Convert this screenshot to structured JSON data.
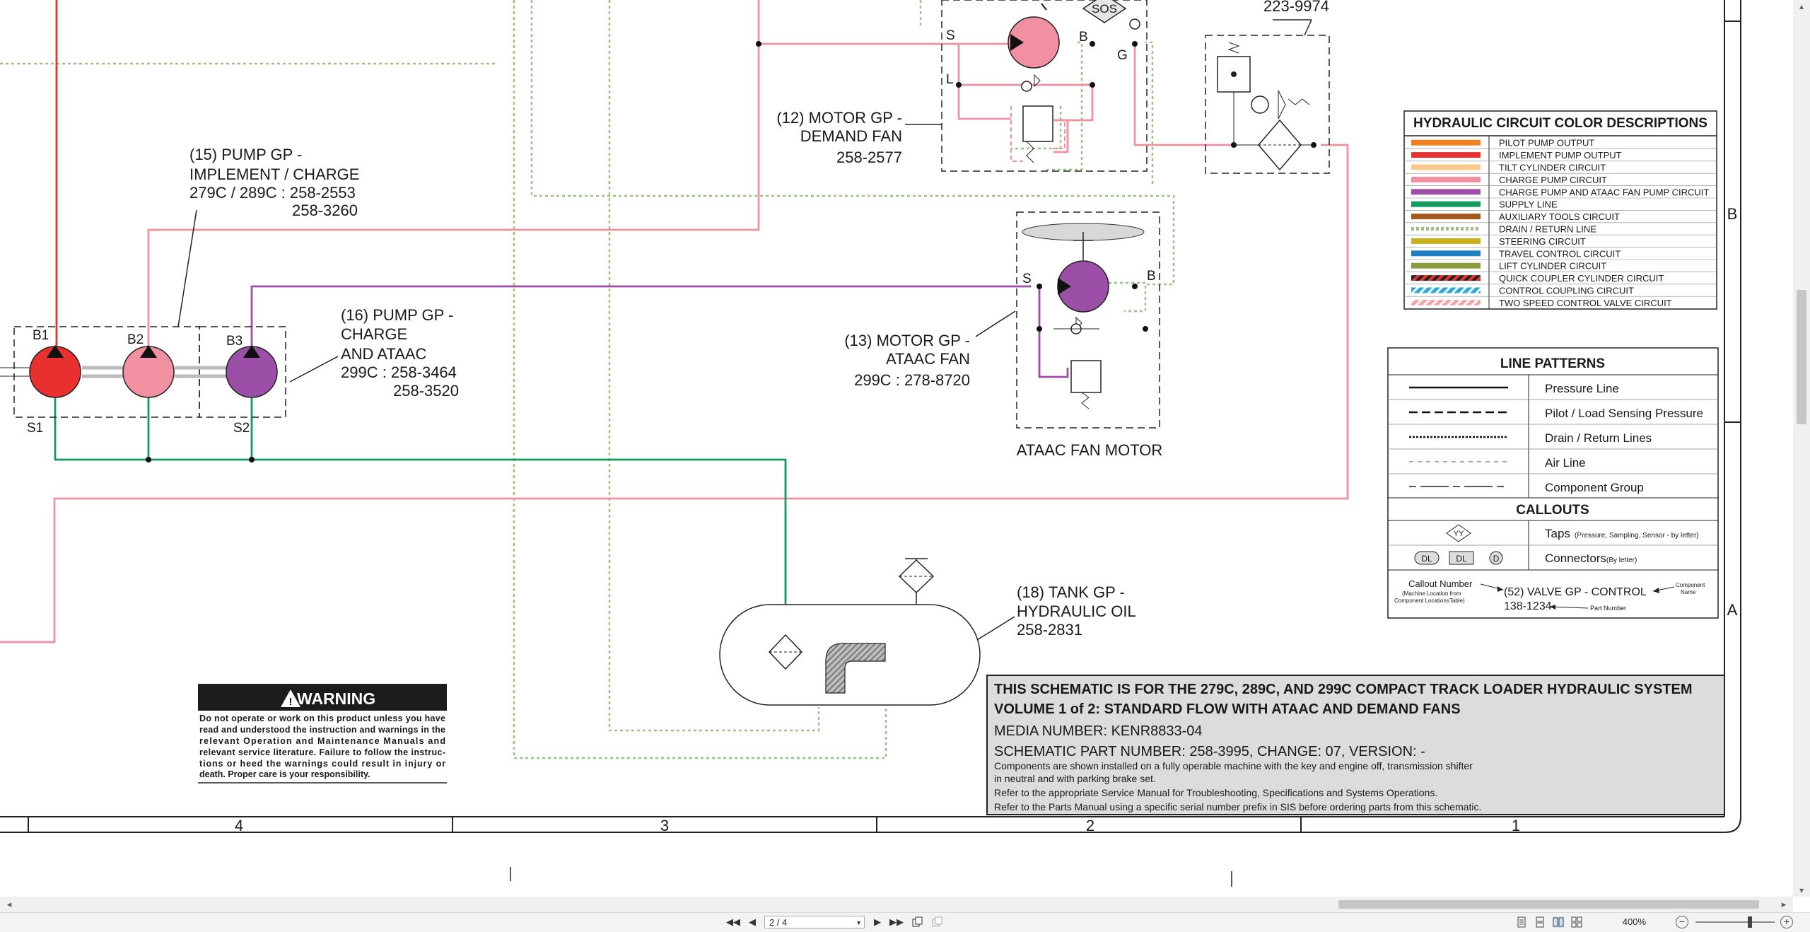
{
  "grid": {
    "columns": [
      "4",
      "3",
      "2",
      "1"
    ],
    "rows": [
      "B",
      "A"
    ]
  },
  "components": {
    "motor12": {
      "callout": "(12) MOTOR GP -",
      "name": "DEMAND FAN",
      "part": "258-2577",
      "ports": {
        "s": "S",
        "b": "B",
        "l": "L",
        "g": "G"
      },
      "sos": "SOS"
    },
    "part_top": "223-9974",
    "pump15": {
      "callout": "(15) PUMP GP -",
      "name": "IMPLEMENT / CHARGE",
      "part1": "279C / 289C : 258-2553",
      "part2": "258-3260",
      "ports": {
        "b1": "B1",
        "b2": "B2",
        "s1": "S1"
      }
    },
    "pump16": {
      "callout": "(16) PUMP GP -",
      "name1": "CHARGE",
      "name2": "AND ATAAC",
      "part1": "299C : 258-3464",
      "part2": "258-3520",
      "ports": {
        "b3": "B3",
        "s2": "S2"
      }
    },
    "motor13": {
      "callout": "(13) MOTOR GP -",
      "name": "ATAAC FAN",
      "part": "299C : 278-8720",
      "ports": {
        "s": "S",
        "b": "B"
      },
      "caption": "ATAAC FAN MOTOR"
    },
    "tank18": {
      "callout": "(18) TANK GP -",
      "name": "HYDRAULIC OIL",
      "part": "258-2831"
    }
  },
  "color_legend": {
    "title": "HYDRAULIC CIRCUIT COLOR DESCRIPTIONS",
    "items": [
      {
        "label": "PILOT PUMP OUTPUT",
        "color": "#f0821e",
        "style": "solid"
      },
      {
        "label": "IMPLEMENT PUMP OUTPUT",
        "color": "#e8312f",
        "style": "solid"
      },
      {
        "label": "TILT CYLINDER CIRCUIT",
        "color": "#f8c88c",
        "style": "solid"
      },
      {
        "label": "CHARGE PUMP CIRCUIT",
        "color": "#f090a0",
        "style": "solid"
      },
      {
        "label": "CHARGE PUMP AND ATAAC FAN PUMP CIRCUIT",
        "color": "#9b4fa6",
        "style": "solid"
      },
      {
        "label": "SUPPLY LINE",
        "color": "#139a5f",
        "style": "solid"
      },
      {
        "label": "AUXILIARY TOOLS CIRCUIT",
        "color": "#a0581c",
        "style": "solid"
      },
      {
        "label": "DRAIN / RETURN LINE",
        "color": "#9cbf85",
        "style": "dotted"
      },
      {
        "label": "STEERING CIRCUIT",
        "color": "#c8b01c",
        "style": "solid"
      },
      {
        "label": "TRAVEL CONTROL CIRCUIT",
        "color": "#1f7fc4",
        "style": "solid"
      },
      {
        "label": "LIFT CYLINDER CIRCUIT",
        "color": "#8d9a3f",
        "style": "solid"
      },
      {
        "label": "QUICK COUPLER CYLINDER CIRCUIT",
        "color": "#e8312f",
        "style": "hatched-dark"
      },
      {
        "label": "CONTROL COUPLING CIRCUIT",
        "color": "#2aa7d8",
        "style": "hatched-light"
      },
      {
        "label": "TWO SPEED CONTROL VALVE CIRCUIT",
        "color": "#f4a4a8",
        "style": "hatched-pink"
      }
    ]
  },
  "line_patterns": {
    "title": "LINE PATTERNS",
    "items": [
      "Pressure Line",
      "Pilot / Load Sensing Pressure",
      "Drain / Return Lines",
      "Air Line",
      "Component Group"
    ],
    "callouts_title": "CALLOUTS",
    "taps_label": "Taps",
    "taps_note": "(Pressure, Sampling, Sensor - by letter)",
    "taps_symbol": "YY",
    "connectors_label": "Connectors",
    "connectors_note": "(By letter)",
    "connector_symbols": [
      "DL",
      "DL",
      "D"
    ],
    "example": {
      "callout_number": "Callout Number",
      "callout_note1": "(Machine Location from",
      "callout_note2": "Component LocationsTable)",
      "callout": "(52) VALVE GP - CONTROL",
      "part": "138-1234",
      "part_label": "Part Number",
      "component_label1": "Component",
      "component_label2": "Name"
    }
  },
  "warning": {
    "title": "WARNING",
    "lines": [
      "Do not operate or work on this product unless you have",
      "read and understood the instruction and warnings in the",
      "relevant Operation and Maintenance Manuals and",
      "relevant service literature. Failure to follow the instruc-",
      "tions or heed the warnings could result in injury or",
      "death. Proper care is your responsibility."
    ]
  },
  "title_block": {
    "line1": "THIS SCHEMATIC IS FOR THE 279C, 289C, AND 299C COMPACT TRACK LOADER HYDRAULIC SYSTEM",
    "line2": "VOLUME 1 of 2: STANDARD FLOW WITH ATAAC AND DEMAND FANS",
    "media": "MEDIA NUMBER: KENR8833-04",
    "schematic": "SCHEMATIC PART NUMBER: 258-3995, CHANGE: 07, VERSION: -",
    "notes": [
      "Components are shown installed on a fully operable machine with the key and engine off, transmission shifter",
      "in neutral and with parking brake set.",
      "Refer to the appropriate Service Manual for Troubleshooting, Specifications and Systems Operations.",
      "Refer to the Parts Manual using a specific serial number prefix in SIS before ordering parts from this schematic."
    ]
  },
  "viewer": {
    "page": "2 / 4",
    "zoom": "400%"
  }
}
